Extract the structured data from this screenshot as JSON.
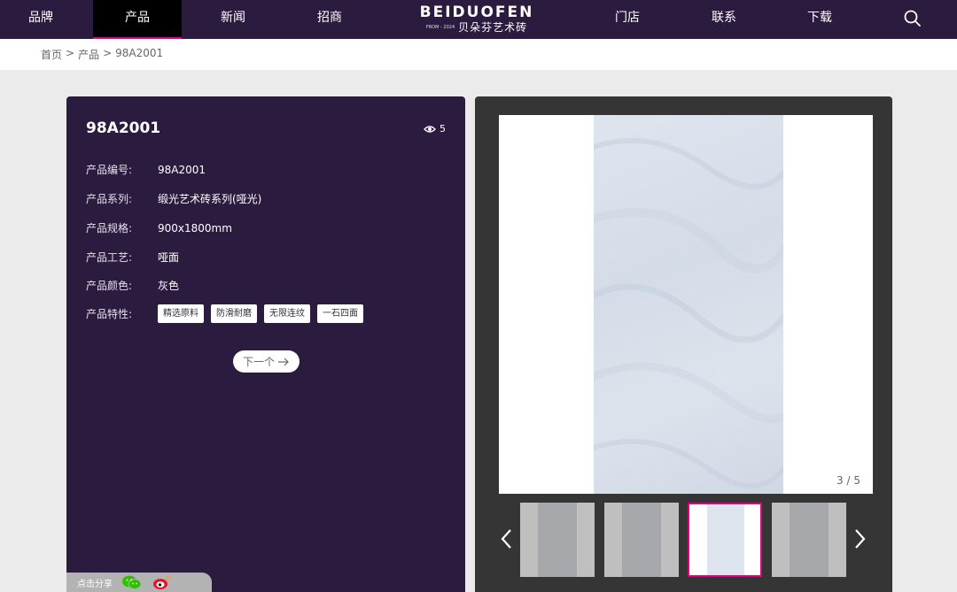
{
  "nav": {
    "items_left": [
      "品牌",
      "产品",
      "新闻",
      "招商"
    ],
    "items_right": [
      "门店",
      "联系",
      "下载"
    ],
    "active": "产品",
    "logo_en": "BEIDUOFEN",
    "logo_from": "FROM - 2024",
    "logo_cn": "贝朵芬艺术砖",
    "accent_color": "#e5007f",
    "bg_color": "#2b1b3f"
  },
  "breadcrumb": {
    "items": [
      "首页",
      "产品",
      "98A2001"
    ],
    "separator": ">"
  },
  "product": {
    "title": "98A2001",
    "views": "5",
    "specs": [
      {
        "label": "产品编号:",
        "value": "98A2001"
      },
      {
        "label": "产品系列:",
        "value": "缎光艺术砖系列(哑光)"
      },
      {
        "label": "产品规格:",
        "value": "900x1800mm"
      },
      {
        "label": "产品工艺:",
        "value": "哑面"
      },
      {
        "label": "产品颜色:",
        "value": "灰色"
      }
    ],
    "features_label": "产品特性:",
    "features": [
      "精选原料",
      "防滑耐磨",
      "无限连纹",
      "一石四面"
    ],
    "next_label": "下一个"
  },
  "share": {
    "label": "点击分享",
    "icons": [
      "wechat-icon",
      "weibo-icon"
    ]
  },
  "gallery": {
    "counter": "3 / 5",
    "thumb_count": 4,
    "active_thumb": 3
  }
}
